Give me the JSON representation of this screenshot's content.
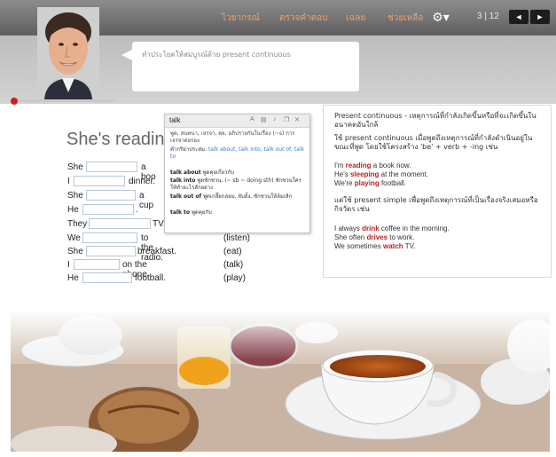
{
  "toolbar": {
    "nav": [
      "ไวยากรณ์",
      "ตรวจคำตอบ",
      "เฉลย",
      "ช่วยเหลือ"
    ],
    "page": "3 | 12",
    "prev": "◄",
    "next": "►"
  },
  "instruction": "ทำประโยคให้สมบูรณ์ด้วย present continuous",
  "exercise": {
    "title": "She's reading a",
    "rows": [
      {
        "before": "She",
        "after": "a boo",
        "hint": ""
      },
      {
        "before": "I",
        "after": "dinner.",
        "hint": ""
      },
      {
        "before": "She",
        "after": "a cup",
        "hint": ""
      },
      {
        "before": "He",
        "after": ".",
        "hint": ""
      },
      {
        "before": "They",
        "after": "TV.",
        "hint": ""
      },
      {
        "before": "We",
        "after": "to the radio.",
        "hint": "(listen)"
      },
      {
        "before": "She",
        "after": "breakfast.",
        "hint": "(eat)"
      },
      {
        "before": "I",
        "after": "on the phone.",
        "hint": "(talk)"
      },
      {
        "before": "He",
        "after": "football.",
        "hint": "(play)"
      }
    ]
  },
  "dictionary": {
    "word": "talk",
    "def1": "พูด, สนทนา, เจรจา, คุย, อภิปรายกันในเรื่อง (~s) การเจรจาต่อรอง",
    "label": "คำกริยาประสม:",
    "links": "talk about, talk into, talk out of, talk to",
    "entries": [
      {
        "term": "talk about",
        "meaning": "พูดคุยเกี่ยวกับ"
      },
      {
        "term": "talk into",
        "meaning": "พูดชักชวน, (~ sb ~ doing sth) ชักชวนใครให้ทำอะไรสักอย่าง"
      },
      {
        "term": "talk out of",
        "meaning": "พูดเกลี้ยกล่อม, ยับยั้ง, ชักชวนให้ล้มเลิก"
      },
      {
        "term": "talk to",
        "meaning": "พูดคุยกับ"
      }
    ]
  },
  "grammar": {
    "intro": "Present continuous - เหตุการณ์ที่กำลังเกิดขึ้นหรือที่จะเกิดขึ้นในอนาคตอันใกล้",
    "use": "ใช้ present continuous เมื่อพูดถึงเหตุการณ์ที่กำลังดำเนินอยู่ในขณะที่พูด โดยใช้โครงสร้าง 'be' + verb + -ing เช่น",
    "examples1": [
      {
        "pre": "I'm ",
        "hl": "reading",
        "post": " a book now."
      },
      {
        "pre": "He's ",
        "hl": "sleeping",
        "post": " at the moment."
      },
      {
        "pre": "We're ",
        "hl": "playing",
        "post": " football."
      }
    ],
    "contrast": "แต่ใช้ present simple เพื่อพูดถึงเหตุการณ์ที่เป็นเรื่องจริงเสมอหรือกิจวัตร เช่น",
    "examples2": [
      {
        "pre": "I always ",
        "hl": "drink",
        "post": " coffee in the morning."
      },
      {
        "pre": "She often ",
        "hl": "drives",
        "post": " to work."
      },
      {
        "pre": "We sometimes ",
        "hl": "watch",
        "post": " TV."
      }
    ]
  },
  "colors": {
    "accent": "#f0a06a",
    "highlight": "#b62323",
    "link": "#3d7bbf"
  }
}
